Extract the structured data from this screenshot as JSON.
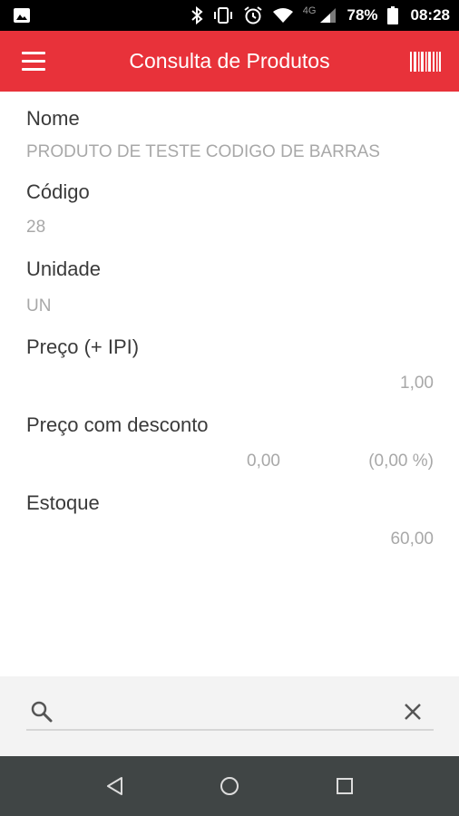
{
  "status_bar": {
    "network_label": "4G",
    "battery_percent": "78%",
    "time": "08:28"
  },
  "app_bar": {
    "title": "Consulta de Produtos",
    "color": "#e8323a"
  },
  "product": {
    "name_label": "Nome",
    "name_value": "PRODUTO DE TESTE CODIGO DE BARRAS",
    "code_label": "Código",
    "code_value": "28",
    "unit_label": "Unidade",
    "unit_value": "UN",
    "price_label": "Preço (+ IPI)",
    "price_value": "1,00",
    "discount_label": "Preço com desconto",
    "discount_value": "0,00",
    "discount_percent": "(0,00 %)",
    "stock_label": "Estoque",
    "stock_value": "60,00"
  },
  "search": {
    "value": "",
    "placeholder": ""
  },
  "icons": {
    "menu": "hamburger-menu-icon",
    "barcode": "barcode-icon",
    "search": "search-icon",
    "clear": "close-icon",
    "back": "back-triangle-icon",
    "home": "home-circle-icon",
    "recents": "recents-square-icon"
  }
}
